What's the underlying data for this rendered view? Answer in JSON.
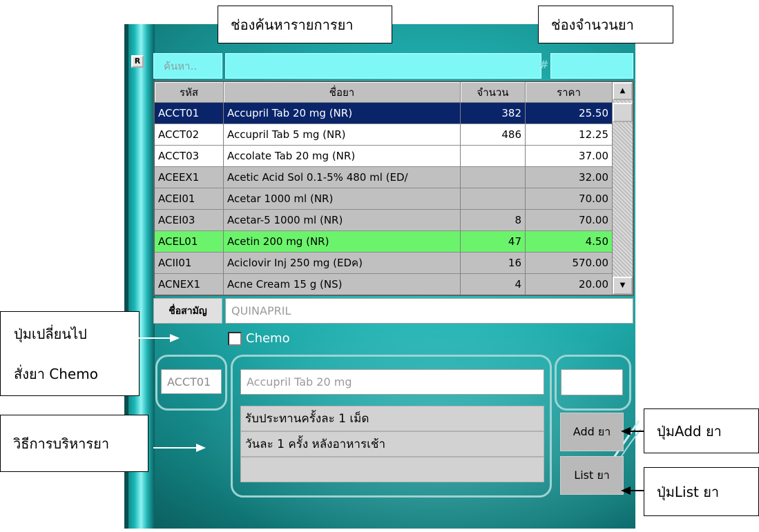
{
  "annotations": {
    "search_field": "ช่องค้นหารายการยา",
    "quantity_field": "ช่องจำนวนยา",
    "chemo_line1": "ปุ่มเปลี่ยนไป",
    "chemo_line2": "สั่งยา Chemo",
    "administration": "วิธีการบริหารยา",
    "add_button": "ปุ่มAdd ยา",
    "list_button": "ปุ่มList ยา"
  },
  "search": {
    "placeholder": "ค้นหา..",
    "quantity_symbol": "#",
    "small_button": "R"
  },
  "table": {
    "headers": [
      "รหัส",
      "ชื่อยา",
      "จำนวน",
      "ราคา"
    ],
    "rows": [
      {
        "code": "ACCT01",
        "name": "Accupril Tab 20 mg  (NR)",
        "qty": "382",
        "price": "25.50",
        "style": "sel"
      },
      {
        "code": "ACCT02",
        "name": "Accupril Tab 5 mg  (NR)",
        "qty": "486",
        "price": "12.25",
        "style": "white"
      },
      {
        "code": "ACCT03",
        "name": "Accolate Tab 20 mg  (NR)",
        "qty": "",
        "price": "37.00",
        "style": "white"
      },
      {
        "code": "ACEEX1",
        "name": "Acetic Acid Sol 0.1-5% 480 ml  (ED/",
        "qty": "",
        "price": "32.00",
        "style": "gray"
      },
      {
        "code": "ACEI01",
        "name": "Acetar 1000 ml  (NR)",
        "qty": "",
        "price": "70.00",
        "style": "gray"
      },
      {
        "code": "ACEI03",
        "name": "Acetar-5 1000 ml  (NR)",
        "qty": "8",
        "price": "70.00",
        "style": "gray"
      },
      {
        "code": "ACEL01",
        "name": "Acetin 200 mg  (NR)",
        "qty": "47",
        "price": "4.50",
        "style": "green"
      },
      {
        "code": "ACII01",
        "name": "Aciclovir Inj 250 mg  (EDค)",
        "qty": "16",
        "price": "570.00",
        "style": "gray"
      },
      {
        "code": "ACNEX1",
        "name": "Acne Cream 15 g  (NS)",
        "qty": "4",
        "price": "20.00",
        "style": "gray"
      }
    ]
  },
  "generic": {
    "label": "ชื่อสามัญ",
    "value": "QUINAPRIL"
  },
  "chemo": {
    "label": "Chemo",
    "checked": false
  },
  "order": {
    "code": "ACCT01",
    "drug_name": "Accupril Tab 20 mg",
    "quantity": "",
    "instructions": [
      "รับประทานครั้งละ 1 เม็ด",
      "วันละ 1 ครั้ง หลังอาหารเช้า",
      ""
    ]
  },
  "buttons": {
    "add": "Add ยา",
    "list": "List ยา"
  },
  "colors": {
    "selected_row": "#0a246a",
    "highlight_row": "#6bf36b",
    "panel": "#1fa8a8",
    "field": "#7ff7f7"
  }
}
